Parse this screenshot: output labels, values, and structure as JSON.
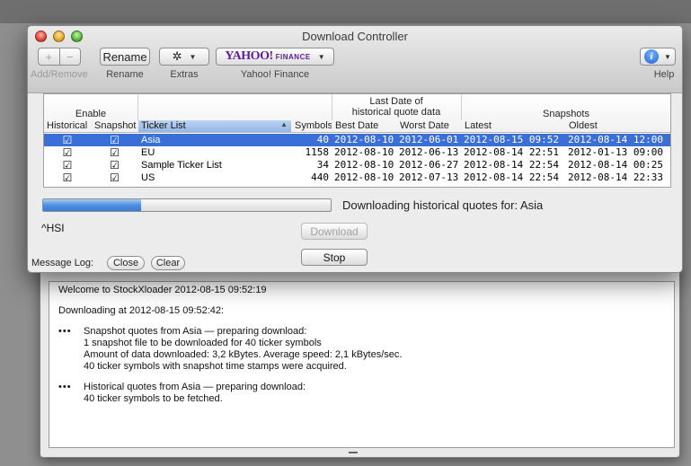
{
  "window": {
    "title": "Download Controller"
  },
  "toolbar": {
    "add_remove": {
      "plus": "+",
      "minus": "−",
      "label": "Add/Remove"
    },
    "rename": {
      "button": "Rename",
      "label": "Rename"
    },
    "extras": {
      "button": "✲",
      "label": "Extras"
    },
    "yahoo": {
      "logo": "YAHOO!",
      "logo_sub": "FINANCE",
      "label": "Yahoo! Finance"
    },
    "help": {
      "button": "i",
      "label": "Help"
    }
  },
  "table": {
    "group_headers": {
      "enable": "Enable",
      "last_date": "Last Date of",
      "last_date_2": "historical quote data",
      "snapshots": "Snapshots"
    },
    "columns": [
      "Historical",
      "Snapshot",
      "Ticker List",
      "Symbols",
      "Best Date",
      "Worst Date",
      "Latest",
      "Oldest"
    ],
    "rows": [
      {
        "historical": "☑",
        "snapshot": "☑",
        "ticker_list": "Asia",
        "symbols": "40",
        "best_date": "2012-08-10",
        "worst_date": "2012-06-01",
        "latest": "2012-08-15 09:52",
        "oldest": "2012-08-14 12:00",
        "selected": true
      },
      {
        "historical": "☑",
        "snapshot": "☑",
        "ticker_list": "EU",
        "symbols": "1158",
        "best_date": "2012-08-10",
        "worst_date": "2012-06-13",
        "latest": "2012-08-14 22:51",
        "oldest": "2012-01-13 09:00",
        "selected": false
      },
      {
        "historical": "☑",
        "snapshot": "☑",
        "ticker_list": "Sample Ticker List",
        "symbols": "34",
        "best_date": "2012-08-10",
        "worst_date": "2012-06-27",
        "latest": "2012-08-14 22:54",
        "oldest": "2012-08-14 00:25",
        "selected": false
      },
      {
        "historical": "☑",
        "snapshot": "☑",
        "ticker_list": "US",
        "symbols": "440",
        "best_date": "2012-08-10",
        "worst_date": "2012-07-13",
        "latest": "2012-08-14 22:54",
        "oldest": "2012-08-14 22:33",
        "selected": false
      }
    ]
  },
  "progress": {
    "fraction": 0.34
  },
  "status_text": "Downloading historical quotes for: Asia",
  "current_symbol": "^HSI",
  "buttons": {
    "download": "Download",
    "stop": "Stop"
  },
  "message_log": {
    "label": "Message Log:",
    "close": "Close",
    "clear": "Clear"
  },
  "log": {
    "welcome": "Welcome to StockXloader  2012-08-15 09:52:19",
    "downloading_at": "Downloading at  2012-08-15 09:52:42:",
    "bullet": "•••",
    "entries": [
      {
        "line1": "Snapshot quotes from Asia — preparing download:",
        "line2": "1 snapshot file to be downloaded for 40 ticker symbols",
        "line3": "Amount of data downloaded:  3,2  kBytes.  Average speed:  2,1  kBytes/sec.",
        "line4": "40 ticker symbols with snapshot time stamps were acquired."
      },
      {
        "line1": "Historical quotes from Asia — preparing download:",
        "line2": "40 ticker symbols to be fetched."
      }
    ]
  },
  "colors": {
    "selection": "#3a6fd8",
    "yahoo_purple": "#5e1b9e",
    "progress_blue": "#4f8fe0"
  }
}
